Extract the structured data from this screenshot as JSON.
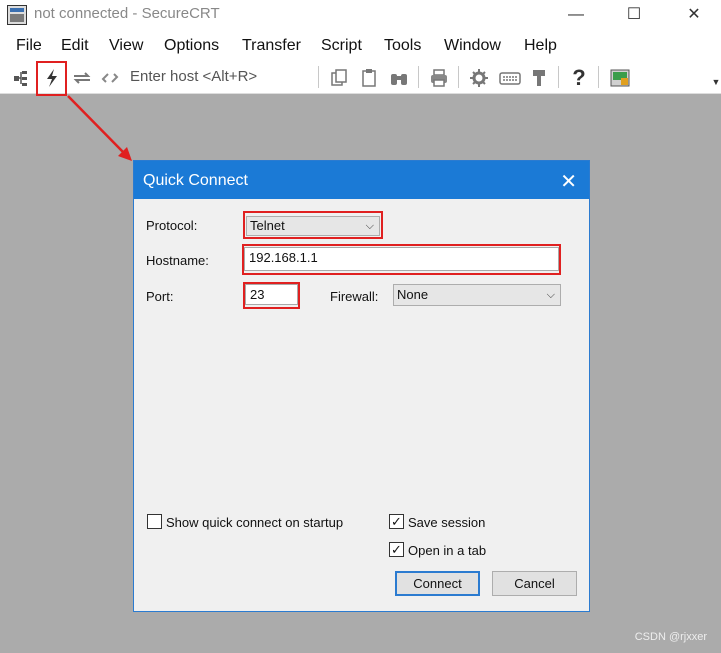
{
  "window": {
    "title": "not connected - SecureCRT",
    "minimize": "—",
    "maximize": "☐",
    "close": "✕"
  },
  "menu": [
    "File",
    "Edit",
    "View",
    "Options",
    "Transfer",
    "Script",
    "Tools",
    "Window",
    "Help"
  ],
  "toolbar": {
    "host_placeholder": "Enter host <Alt+R>",
    "help": "?"
  },
  "dialog": {
    "title": "Quick Connect",
    "protocol_label": "Protocol:",
    "protocol_value": "Telnet",
    "hostname_label": "Hostname:",
    "hostname_value": "192.168.1.1",
    "port_label": "Port:",
    "port_value": "23",
    "firewall_label": "Firewall:",
    "firewall_value": "None",
    "show_on_startup_label": "Show quick connect on startup",
    "show_on_startup_checked": false,
    "save_session_label": "Save session",
    "save_session_checked": true,
    "open_in_tab_label": "Open in a tab",
    "open_in_tab_checked": true,
    "connect_label": "Connect",
    "cancel_label": "Cancel"
  },
  "watermark": "CSDN @rjxxer"
}
